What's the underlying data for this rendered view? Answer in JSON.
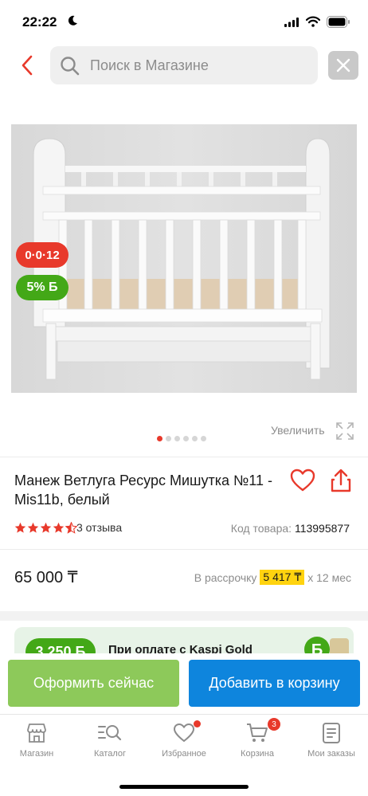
{
  "status_bar": {
    "time": "22:22"
  },
  "search": {
    "placeholder": "Поиск в Магазине"
  },
  "product": {
    "badge_installment": "0·0·12",
    "badge_bonus": "5% Б",
    "zoom_label": "Увеличить",
    "image_count": 6,
    "active_image": 1,
    "title": "Манеж Ветлуга Ресурс Мишутка №11 - Mis11b, белый",
    "rating": 4.5,
    "reviews": "3 отзыва",
    "code_label": "Код товара:",
    "code_value": "113995877",
    "price": "65 000 ₸",
    "installment_prefix": "В рассрочку",
    "installment_amount": "5 417 ₸",
    "installment_suffix": "х 12 мес"
  },
  "gold_banner": {
    "badge": "3 250 Б",
    "text": "При оплате с Kaspi Gold"
  },
  "actions": {
    "order_label": "Оформить сейчас",
    "cart_label": "Добавить в корзину"
  },
  "nav": {
    "items": [
      {
        "label": "Магазин",
        "icon": "shop-icon"
      },
      {
        "label": "Каталог",
        "icon": "catalog-search-icon"
      },
      {
        "label": "Избранное",
        "icon": "heart-icon"
      },
      {
        "label": "Корзина",
        "icon": "cart-icon",
        "count": "3"
      },
      {
        "label": "Мои заказы",
        "icon": "orders-icon"
      }
    ]
  },
  "colors": {
    "accent_red": "#e8392b",
    "bonus_green": "#43a817",
    "order_green": "#8dc95a",
    "cart_blue": "#0e85dd",
    "installment_yellow": "#ffd30f"
  }
}
